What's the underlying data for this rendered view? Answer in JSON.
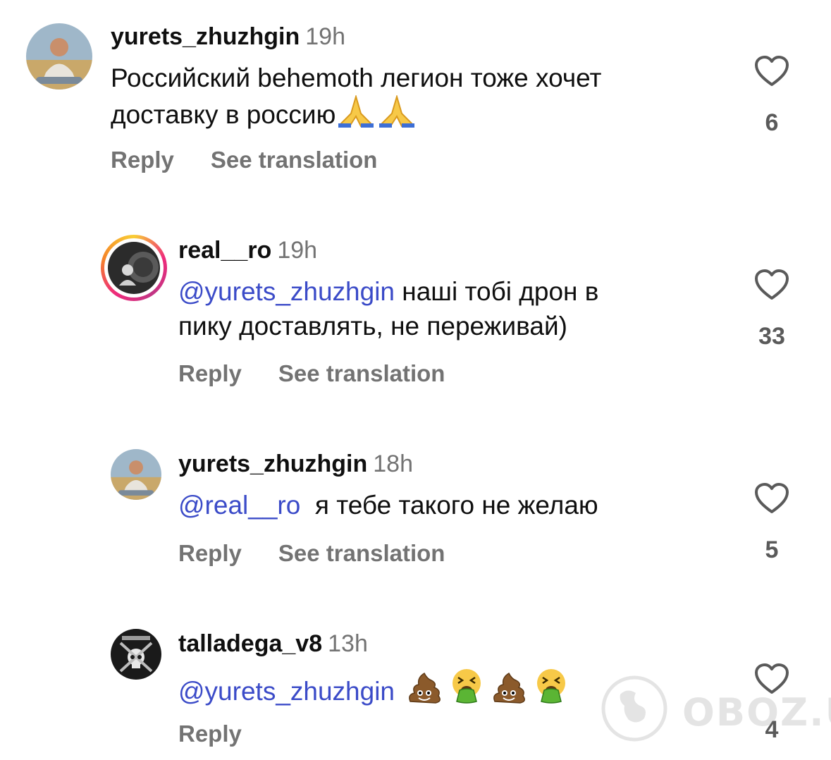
{
  "comments": [
    {
      "username": "yurets_zhuzhgin",
      "time": "19h",
      "line1": "Российский behemoth легион тоже хочет",
      "line2": "доставку в россию",
      "reply": "Reply",
      "translate": "See translation",
      "likes": "6"
    },
    {
      "username": "real__ro",
      "time": "19h",
      "mention": "@yurets_zhuzhgin",
      "line1": " наші тобі дрон в",
      "line2": "пику доставлять, не переживай)",
      "reply": "Reply",
      "translate": "See translation",
      "likes": "33"
    },
    {
      "username": "yurets_zhuzhgin",
      "time": "18h",
      "mention": "@real__ro",
      "line1": "  я тебе такого не желаю",
      "reply": "Reply",
      "translate": "See translation",
      "likes": "5"
    },
    {
      "username": "talladega_v8",
      "time": "13h",
      "mention": "@yurets_zhuzhgin",
      "reply": "Reply",
      "likes": "4"
    }
  ],
  "watermark": "OBOZ.UA",
  "colors": {
    "mention": "#3b4bc8",
    "secondary": "#737373",
    "story_ring": "#ee2a7b"
  },
  "icons": [
    "heart-icon",
    "folded-hands-emoji",
    "pile-of-poo-emoji",
    "vomiting-face-emoji"
  ]
}
